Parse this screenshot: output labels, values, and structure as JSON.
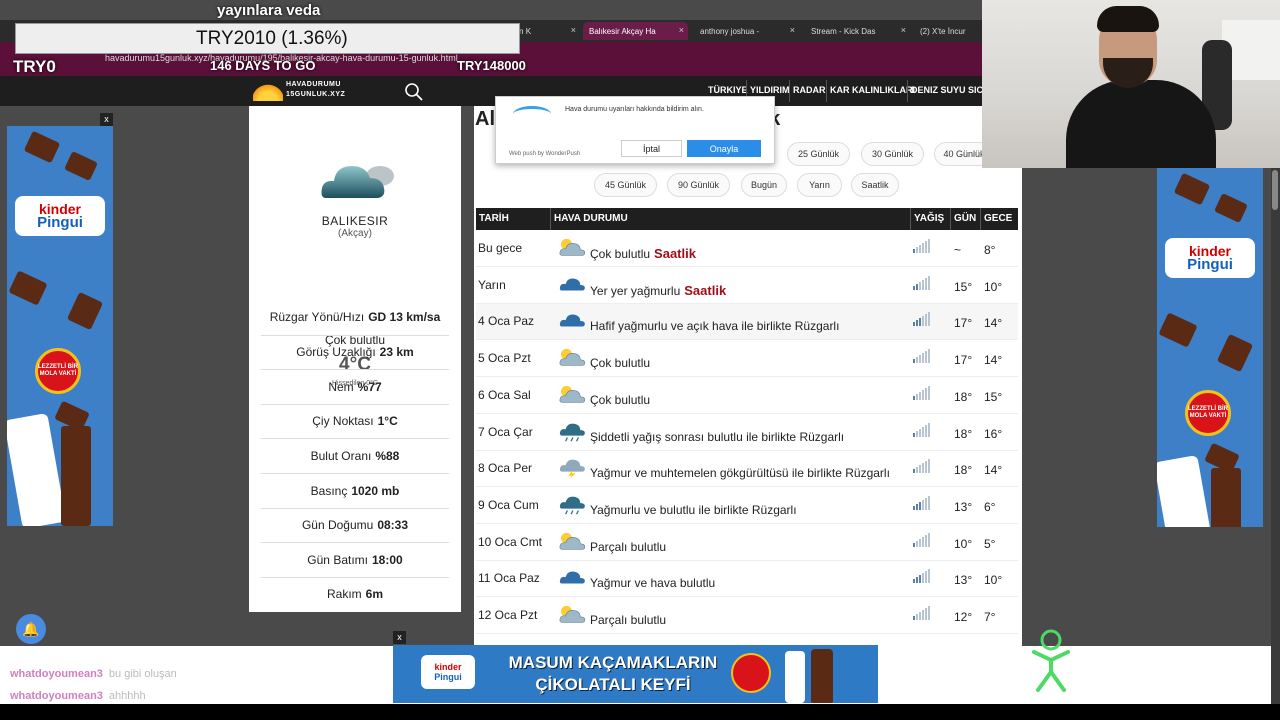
{
  "overlays": {
    "title": "yayınlara veda",
    "box": "TRY2010 (1.36%)",
    "left": "TRY0",
    "mid": "146 DAYS TO GO",
    "right": "TRY148000"
  },
  "browser": {
    "url": "havadurumu15gunluk.xyz/havadurumu/195/balikesir-akcay-hava-durumu-15-gunluk.html",
    "tabs": [
      {
        "label": "arının En K"
      },
      {
        "label": "Balıkesir Akçay Ha"
      },
      {
        "label": "anthony joshua -"
      },
      {
        "label": "Stream - Kick Das"
      },
      {
        "label": "(2) X'te İncur"
      }
    ]
  },
  "site": {
    "logo_line1": "HAVADURUMU",
    "logo_line2": "15GUNLUK.XYZ",
    "nav": [
      "TÜRKIYE",
      "YILDIRIM",
      "RADAR",
      "KAR KALINLIKLARI",
      "DENIZ SUYU SICA"
    ]
  },
  "current": {
    "city": "BALIKESIR",
    "district": "(Akçay)",
    "condition": "Çok bulutlu",
    "temp": "4°C",
    "feels": "Hissedilen 0°C",
    "stats": [
      {
        "label": "Rüzgar Yönü/Hızı",
        "value": "GD 13 km/sa"
      },
      {
        "label": "Görüş Uzaklığı",
        "value": "23 km"
      },
      {
        "label": "Nem",
        "value": "%77"
      },
      {
        "label": "Çiy Noktası",
        "value": "1°C"
      },
      {
        "label": "Bulut Oranı",
        "value": "%88"
      },
      {
        "label": "Basınç",
        "value": "1020 mb"
      },
      {
        "label": "Gün Doğumu",
        "value": "08:33"
      },
      {
        "label": "Gün Batımı",
        "value": "18:00"
      },
      {
        "label": "Rakım",
        "value": "6m"
      }
    ]
  },
  "main": {
    "title_start": "Al",
    "title_end": "lik",
    "pills_row1": [
      "25 Günlük",
      "30 Günlük",
      "40 Günlük"
    ],
    "pills_row2": [
      "45 Günlük",
      "90 Günlük",
      "Bugün",
      "Yarın",
      "Saatlik"
    ]
  },
  "popup": {
    "text": "Hava durumu uyarıları hakkında bildirim alın.",
    "brand": "Web push by WonderPush",
    "cancel": "İptal",
    "ok": "Onayla"
  },
  "table": {
    "headers": [
      "TARİH",
      "HAVA DURUMU",
      "YAĞIŞ",
      "GÜN",
      "GECE"
    ],
    "hourly_label": "Saatlik",
    "rows": [
      {
        "date": "Bu gece",
        "desc": "Çok bulutlu",
        "hourly": true,
        "icon": "partly-cloudy-icon",
        "rain": 1,
        "day": "~",
        "night": "8°"
      },
      {
        "date": "Yarın",
        "desc": "Yer yer yağmurlu",
        "hourly": true,
        "icon": "rain-cloud-icon",
        "rain": 2,
        "day": "15°",
        "night": "10°"
      },
      {
        "date": "4 Oca Paz",
        "desc": "Hafif yağmurlu ve açık hava ile birlikte Rüzgarlı",
        "hourly": false,
        "icon": "rain-cloud-icon",
        "rain": 3,
        "day": "17°",
        "night": "14°"
      },
      {
        "date": "5 Oca Pzt",
        "desc": "Çok bulutlu",
        "hourly": false,
        "icon": "partly-cloudy-icon",
        "rain": 1,
        "day": "17°",
        "night": "14°"
      },
      {
        "date": "6 Oca Sal",
        "desc": "Çok bulutlu",
        "hourly": false,
        "icon": "partly-cloudy-icon",
        "rain": 1,
        "day": "18°",
        "night": "15°"
      },
      {
        "date": "7 Oca Çar",
        "desc": "Şiddetli yağış sonrası bulutlu ile birlikte Rüzgarlı",
        "hourly": false,
        "icon": "heavy-rain-icon",
        "rain": 1,
        "day": "18°",
        "night": "16°"
      },
      {
        "date": "8 Oca Per",
        "desc": "Yağmur ve muhtemelen gökgürültüsü ile birlikte Rüzgarlı",
        "hourly": false,
        "icon": "thunder-icon",
        "rain": 1,
        "day": "18°",
        "night": "14°"
      },
      {
        "date": "9 Oca Cum",
        "desc": "Yağmurlu ve bulutlu ile birlikte Rüzgarlı",
        "hourly": false,
        "icon": "heavy-rain-icon",
        "rain": 3,
        "day": "13°",
        "night": "6°"
      },
      {
        "date": "10 Oca Cmt",
        "desc": "Parçalı bulutlu",
        "hourly": false,
        "icon": "partly-cloudy-icon",
        "rain": 1,
        "day": "10°",
        "night": "5°"
      },
      {
        "date": "11 Oca Paz",
        "desc": "Yağmur ve hava bulutlu",
        "hourly": false,
        "icon": "rain-cloud-icon",
        "rain": 3,
        "day": "13°",
        "night": "10°"
      },
      {
        "date": "12 Oca Pzt",
        "desc": "Parçalı bulutlu",
        "hourly": false,
        "icon": "partly-cloudy-icon",
        "rain": 1,
        "day": "12°",
        "night": "7°"
      }
    ]
  },
  "ads": {
    "brand_top": "kinder",
    "brand_bottom": "Pingui",
    "clock_text": "LEZZETLİ BİR MOLA VAKTİ",
    "bottom_slogan_1": "MASUM KAÇAMAKLARIN",
    "bottom_slogan_2": "ÇİKOLATALI KEYFİ",
    "close": "x"
  },
  "chat": [
    {
      "user": "whatdoyoumean3",
      "msg": "bu gibi oluşan"
    },
    {
      "user": "whatdoyoumean3",
      "msg": "ahhhhh"
    }
  ],
  "colors": {
    "hourly": "#a00f17",
    "accent": "#2a8ee8",
    "addressbar": "#5a1038"
  }
}
